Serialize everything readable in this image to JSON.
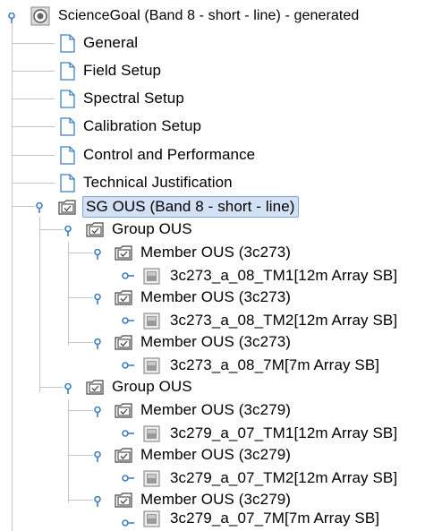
{
  "tree": {
    "root": {
      "label": "ScienceGoal (Band 8 - short - line) - generated",
      "icon": "science-goal-icon"
    },
    "sections": [
      {
        "label": "General",
        "icon": "document-icon"
      },
      {
        "label": "Field Setup",
        "icon": "document-icon"
      },
      {
        "label": "Spectral Setup",
        "icon": "document-icon"
      },
      {
        "label": "Calibration Setup",
        "icon": "document-icon"
      },
      {
        "label": "Control and Performance",
        "icon": "document-icon"
      },
      {
        "label": "Technical Justification",
        "icon": "document-icon"
      }
    ],
    "sg_ous": {
      "label": "SG OUS (Band 8 - short - line)",
      "selected": true,
      "icon": "folder-check-icon"
    },
    "groups": [
      {
        "label": "Group OUS",
        "members": [
          {
            "label": "Member OUS (3c273)",
            "sb": "3c273_a_08_TM1[12m Array SB]"
          },
          {
            "label": "Member OUS (3c273)",
            "sb": "3c273_a_08_TM2[12m Array SB]"
          },
          {
            "label": "Member OUS (3c273)",
            "sb": "3c273_a_08_7M[7m Array SB]"
          }
        ]
      },
      {
        "label": "Group OUS",
        "members": [
          {
            "label": "Member OUS (3c279)",
            "sb": "3c279_a_07_TM1[12m Array SB]"
          },
          {
            "label": "Member OUS (3c279)",
            "sb": "3c279_a_07_TM2[12m Array SB]"
          },
          {
            "label": "Member OUS (3c279)",
            "sb": "3c279_a_07_7M[7m Array SB]"
          }
        ]
      }
    ],
    "colors": {
      "toggle": "#3d7fc6",
      "lines": "#c4c4c4",
      "selection_bg": "#d3e1f5",
      "selection_border": "#7fa6d8"
    }
  }
}
